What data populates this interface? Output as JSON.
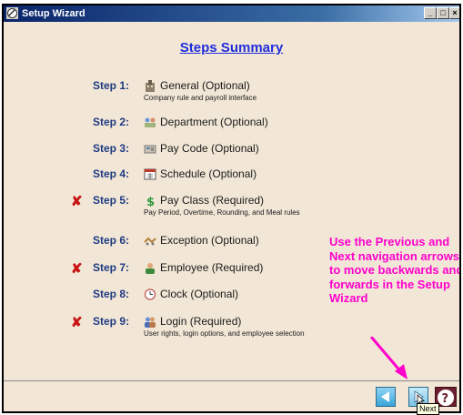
{
  "window": {
    "title": "Setup Wizard"
  },
  "heading": "Steps Summary",
  "steps": [
    {
      "num": "Step 1:",
      "label": "General (Optional)",
      "desc": "Company rule and payroll interface",
      "icon": "building-icon",
      "required": false
    },
    {
      "num": "Step 2:",
      "label": "Department (Optional)",
      "desc": "",
      "icon": "department-icon",
      "required": false
    },
    {
      "num": "Step 3:",
      "label": "Pay Code (Optional)",
      "desc": "",
      "icon": "pay-code-icon",
      "required": false
    },
    {
      "num": "Step 4:",
      "label": "Schedule (Optional)",
      "desc": "",
      "icon": "calendar-icon",
      "required": false
    },
    {
      "num": "Step 5:",
      "label": "Pay Class (Required)",
      "desc": "Pay Period, Overtime, Rounding, and Meal rules",
      "icon": "dollar-icon",
      "required": true
    },
    {
      "num": "Step 6:",
      "label": "Exception (Optional)",
      "desc": "",
      "icon": "exception-icon",
      "required": false
    },
    {
      "num": "Step 7:",
      "label": "Employee (Required)",
      "desc": "",
      "icon": "employee-icon",
      "required": true
    },
    {
      "num": "Step 8:",
      "label": "Clock (Optional)",
      "desc": "",
      "icon": "clock-icon",
      "required": false
    },
    {
      "num": "Step 9:",
      "label": "Login (Required)",
      "desc": "User rights, login options, and employee selection",
      "icon": "login-icon",
      "required": true
    }
  ],
  "required_mark": "✘",
  "annotation": "Use the Previous and Next navigation arrows to move backwards and forwards in the Setup Wizard",
  "tooltip": "Next",
  "colors": {
    "accent": "#1f2ddc",
    "annotation": "#ff00cc",
    "required": "#c81414",
    "background": "#f2e7d6"
  }
}
